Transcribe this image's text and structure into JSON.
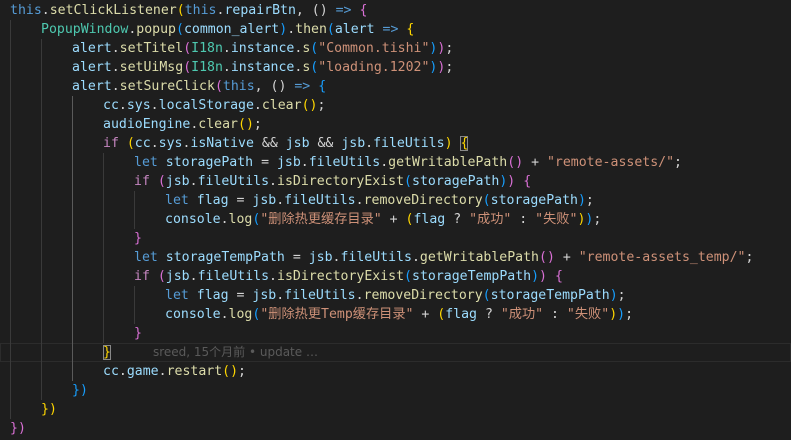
{
  "editor": {
    "theme_background": "#1e1e1e",
    "blame_annotation": "sreed, 15个月前 • update …",
    "code": {
      "l1": {
        "this": "this",
        "dot1": ".",
        "fn": "setClickListener",
        "p_open": "(",
        "this2": "this",
        "dot2": ".",
        "prop": "repairBtn",
        "rest": ", () ",
        "arrow": "=>",
        "sp": " ",
        "brace": "{"
      },
      "l2": {
        "cls": "PopupWindow",
        "dot": ".",
        "fn": "popup",
        "p_open": "(",
        "arg": "common_alert",
        "p_close": ")",
        "dot2": ".",
        "fn2": "then",
        "p2_open": "(",
        "param": "alert",
        "sp": " ",
        "arrow": "=>",
        "sp2": " ",
        "brace": "{"
      },
      "l3": {
        "obj": "alert",
        "dot": ".",
        "fn": "setTitel",
        "p_open": "(",
        "cls": "I18n",
        "dot2": ".",
        "prop": "instance",
        "dot3": ".",
        "fn2": "s",
        "p2_open": "(",
        "str": "\"Common.tishi\"",
        "p2_close": ")",
        "p_close": ")",
        "semi": ";"
      },
      "l4": {
        "obj": "alert",
        "dot": ".",
        "fn": "setUiMsg",
        "p_open": "(",
        "cls": "I18n",
        "dot2": ".",
        "prop": "instance",
        "dot3": ".",
        "fn2": "s",
        "p2_open": "(",
        "str": "\"loading.1202\"",
        "p2_close": ")",
        "p_close": ")",
        "semi": ";"
      },
      "l5": {
        "obj": "alert",
        "dot": ".",
        "fn": "setSureClick",
        "p_open": "(",
        "this": "this",
        "rest": ", () ",
        "arrow": "=>",
        "sp": " ",
        "brace": "{"
      },
      "l6": {
        "a": "cc",
        "d1": ".",
        "b": "sys",
        "d2": ".",
        "c": "localStorage",
        "d3": ".",
        "fn": "clear",
        "p_open": "(",
        "p_close": ")",
        "semi": ";"
      },
      "l7": {
        "a": "audioEngine",
        "d1": ".",
        "fn": "clear",
        "p_open": "(",
        "p_close": ")",
        "semi": ";"
      },
      "l8": {
        "kw": "if",
        "sp": " ",
        "p_open": "(",
        "a": "cc",
        "d1": ".",
        "b": "sys",
        "d2": ".",
        "c": "isNative",
        "and1": " && ",
        "d": "jsb",
        "and2": " && ",
        "e": "jsb",
        "d3": ".",
        "f": "fileUtils",
        "p_close": ")",
        "sp2": " ",
        "brace": "{"
      },
      "l9": {
        "kw": "let",
        "sp": " ",
        "v": "storagePath",
        "eq": " = ",
        "a": "jsb",
        "d1": ".",
        "b": "fileUtils",
        "d2": ".",
        "fn": "getWritablePath",
        "p_open": "(",
        "p_close": ")",
        "plus": " + ",
        "str": "\"remote-assets/\"",
        "semi": ";"
      },
      "l10": {
        "kw": "if",
        "sp": " ",
        "p_open": "(",
        "a": "jsb",
        "d1": ".",
        "b": "fileUtils",
        "d2": ".",
        "fn": "isDirectoryExist",
        "p2_open": "(",
        "arg": "storagePath",
        "p2_close": ")",
        "p_close": ")",
        "sp2": " ",
        "brace": "{"
      },
      "l11": {
        "kw": "let",
        "sp": " ",
        "v": "flag",
        "eq": " = ",
        "a": "jsb",
        "d1": ".",
        "b": "fileUtils",
        "d2": ".",
        "fn": "removeDirectory",
        "p_open": "(",
        "arg": "storagePath",
        "p_close": ")",
        "semi": ";"
      },
      "l12": {
        "a": "console",
        "d1": ".",
        "fn": "log",
        "p_open": "(",
        "str": "\"删除热更缓存目录\"",
        "plus": " + ",
        "p2_open": "(",
        "v": "flag",
        "q": " ? ",
        "s1": "\"成功\"",
        "colon": " : ",
        "s2": "\"失败\"",
        "p2_close": ")",
        "p_close": ")",
        "semi": ";"
      },
      "l13": {
        "brace": "}"
      },
      "l14": {
        "kw": "let",
        "sp": " ",
        "v": "storageTempPath",
        "eq": " = ",
        "a": "jsb",
        "d1": ".",
        "b": "fileUtils",
        "d2": ".",
        "fn": "getWritablePath",
        "p_open": "(",
        "p_close": ")",
        "plus": " + ",
        "str": "\"remote-assets_temp/\"",
        "semi": ";"
      },
      "l15": {
        "kw": "if",
        "sp": " ",
        "p_open": "(",
        "a": "jsb",
        "d1": ".",
        "b": "fileUtils",
        "d2": ".",
        "fn": "isDirectoryExist",
        "p2_open": "(",
        "arg": "storageTempPath",
        "p2_close": ")",
        "p_close": ")",
        "sp2": " ",
        "brace": "{"
      },
      "l16": {
        "kw": "let",
        "sp": " ",
        "v": "flag",
        "eq": " = ",
        "a": "jsb",
        "d1": ".",
        "b": "fileUtils",
        "d2": ".",
        "fn": "removeDirectory",
        "p_open": "(",
        "arg": "storageTempPath",
        "p_close": ")",
        "semi": ";"
      },
      "l17": {
        "a": "console",
        "d1": ".",
        "fn": "log",
        "p_open": "(",
        "str": "\"删除热更Temp缓存目录\"",
        "plus": " + ",
        "p2_open": "(",
        "v": "flag",
        "q": " ? ",
        "s1": "\"成功\"",
        "colon": " : ",
        "s2": "\"失败\"",
        "p2_close": ")",
        "p_close": ")",
        "semi": ";"
      },
      "l18": {
        "brace": "}"
      },
      "l19": {
        "brace": "}"
      },
      "l20": {
        "a": "cc",
        "d1": ".",
        "b": "game",
        "d2": ".",
        "fn": "restart",
        "p_open": "(",
        "p_close": ")",
        "semi": ";"
      },
      "l21": {
        "close": "})"
      },
      "l22": {
        "close": "})"
      },
      "l23": {
        "close": "})"
      }
    }
  }
}
